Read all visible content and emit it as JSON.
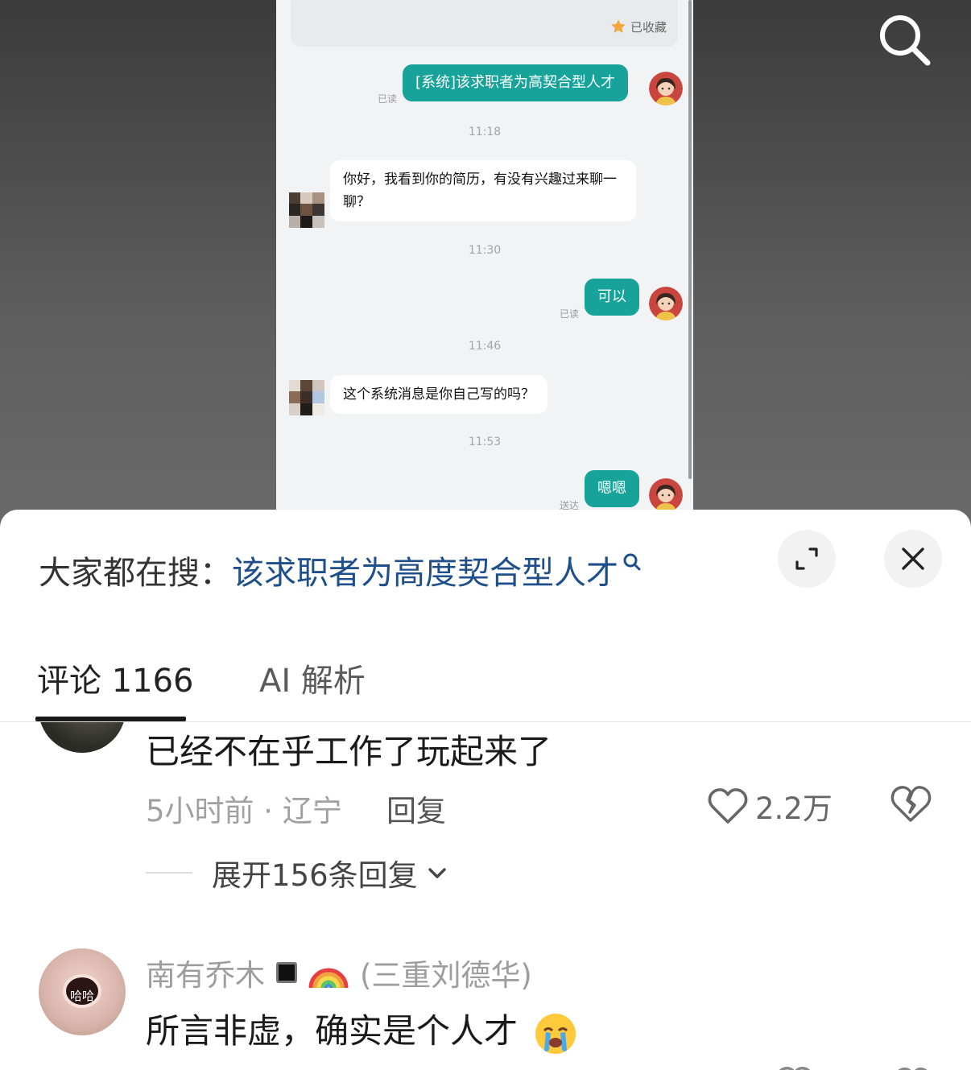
{
  "chat": {
    "favorite_label": "已收藏",
    "messages": [
      {
        "side": "me",
        "text": "[系统]该求职者为高契合型人才",
        "status": "已读"
      },
      {
        "time": "11:18"
      },
      {
        "side": "other",
        "text": "你好，我看到你的简历，有没有兴趣过来聊一聊？"
      },
      {
        "time": "11:30"
      },
      {
        "side": "me",
        "text": "可以",
        "status": "已读"
      },
      {
        "time": "11:46"
      },
      {
        "side": "other",
        "text": "这个系统消息是你自己写的吗？"
      },
      {
        "time": "11:53"
      },
      {
        "side": "me",
        "text": "嗯嗯",
        "status": "送达"
      }
    ]
  },
  "sheet": {
    "hot_prefix": "大家都在搜：",
    "hot_query": "该求职者为高度契合型人才",
    "tabs": [
      {
        "label": "评论 1166",
        "active": true
      },
      {
        "label": "AI 解析",
        "active": false
      }
    ]
  },
  "comments": [
    {
      "text": "已经不在乎工作了玩起来了",
      "meta": "5小时前 · 辽宁",
      "reply_label": "回复",
      "likes": "2.2万",
      "expand_label": "展开156条回复"
    },
    {
      "author": "南有乔木",
      "author_suffix": "(三重刘德华)",
      "avatar_text": "哈哈",
      "text": "所言非虚，确实是个人才"
    }
  ],
  "colors": {
    "my_bubble": "#17a39a",
    "hot_link": "#1f4f8a",
    "sheet_bg": "#ffffff"
  },
  "icons": [
    "search-icon",
    "star-icon",
    "expand-icon",
    "close-icon",
    "search-small-icon",
    "heart-icon",
    "broken-heart-icon",
    "chevron-down-icon",
    "rainbow-icon",
    "crying-face-icon"
  ]
}
